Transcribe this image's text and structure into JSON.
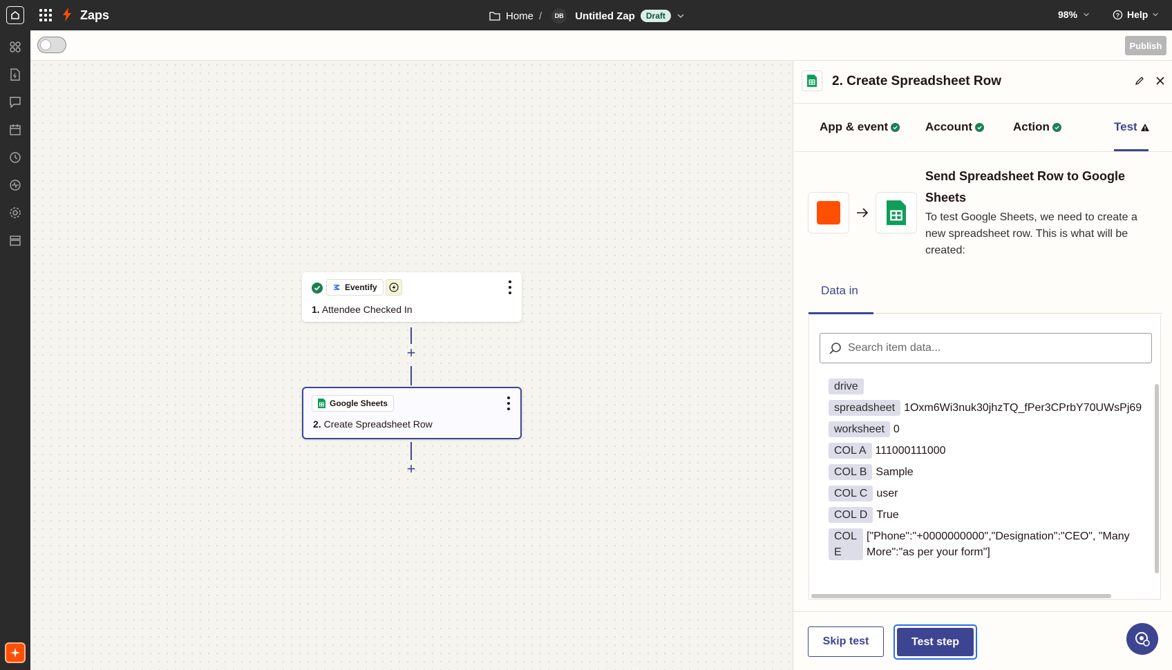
{
  "topbar": {
    "title": "Zaps",
    "breadcrumb_home": "Home",
    "breadcrumb_sep": "/",
    "avatar_initials": "DB",
    "zap_name": "Untitled Zap",
    "status_badge": "Draft",
    "zoom": "98%",
    "help": "Help"
  },
  "subheader": {
    "publish_label": "Publish"
  },
  "sidebar": {
    "icons": [
      "apps-icon",
      "zaps-file-icon",
      "chat-icon",
      "calendar-icon",
      "history-icon",
      "activity-icon",
      "settings-icon",
      "storage-icon"
    ]
  },
  "canvas": {
    "step1": {
      "app": "Eventify",
      "number": "1.",
      "title": "Attendee Checked In"
    },
    "step2": {
      "app": "Google Sheets",
      "number": "2.",
      "title": "Create Spreadsheet Row"
    },
    "plus": "+"
  },
  "panel": {
    "title": "2. Create Spreadsheet Row",
    "tabs": [
      {
        "label": "App & event",
        "status": "ok"
      },
      {
        "label": "Account",
        "status": "ok"
      },
      {
        "label": "Action",
        "status": "ok"
      },
      {
        "label": "Test",
        "status": "warning"
      }
    ],
    "send_title": "Send Spreadsheet Row to Google Sheets",
    "send_desc": "To test Google Sheets, we need to create a new spreadsheet row. This is what will be created:",
    "data_in_tab": "Data in",
    "search_placeholder": "Search item data...",
    "rows": [
      {
        "key": "drive",
        "value": ""
      },
      {
        "key": "spreadsheet",
        "value": "1Oxm6Wi3nuk30jhzTQ_fPer3CPrbY70UWsPj69"
      },
      {
        "key": "worksheet",
        "value": "0"
      },
      {
        "key": "COL A",
        "value": "111000111000"
      },
      {
        "key": "COL B",
        "value": "Sample"
      },
      {
        "key": "COL C",
        "value": "user"
      },
      {
        "key": "COL D",
        "value": "True"
      },
      {
        "key": "COL E",
        "value": "[\"Phone\":\"+0000000000\",\"Designation\":\"CEO\", \"Many More\":\"as per your form\"]"
      }
    ],
    "skip_label": "Skip test",
    "test_label": "Test step"
  },
  "colors": {
    "brand": "#ff4f00",
    "accent": "#3d4592",
    "success": "#1b7f52",
    "sheets_green": "#0f9d58"
  }
}
